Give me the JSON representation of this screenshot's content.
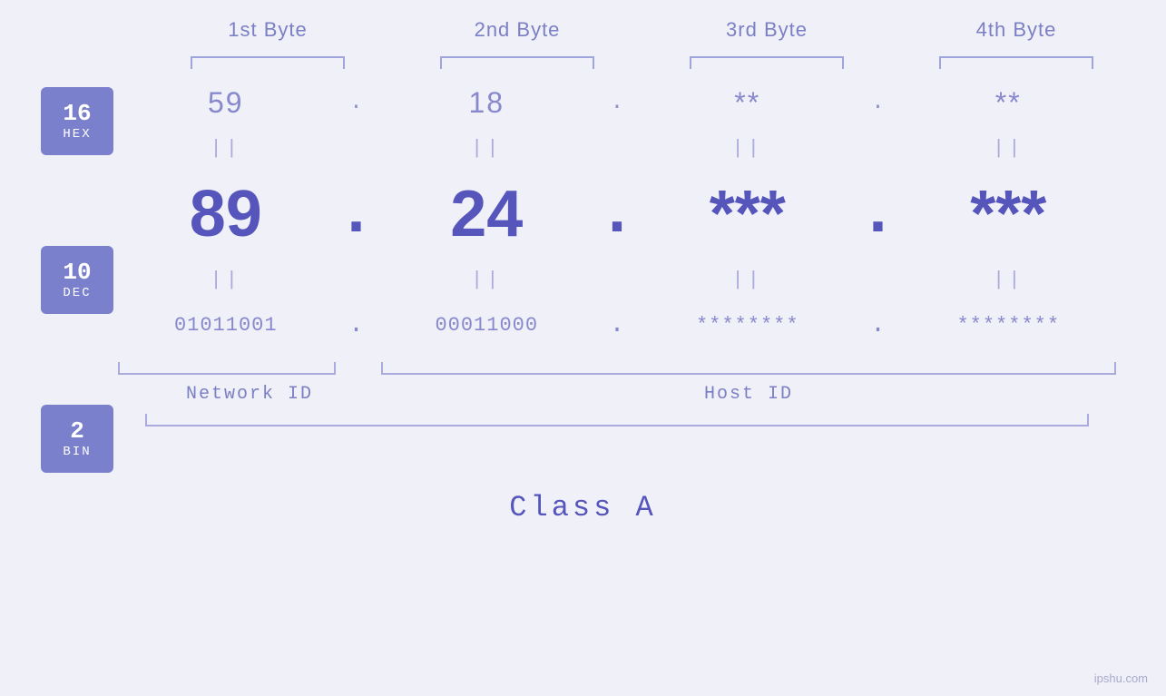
{
  "byteHeaders": {
    "b1": "1st Byte",
    "b2": "2nd Byte",
    "b3": "3rd Byte",
    "b4": "4th Byte"
  },
  "bases": {
    "hex": {
      "num": "16",
      "label": "HEX"
    },
    "dec": {
      "num": "10",
      "label": "DEC"
    },
    "bin": {
      "num": "2",
      "label": "BIN"
    }
  },
  "hexRow": {
    "b1": "59",
    "b2": "18",
    "b3": "**",
    "b4": "**",
    "dot": "."
  },
  "decRow": {
    "b1": "89",
    "b2": "24",
    "b3": "***",
    "b4": "***",
    "dot": "."
  },
  "binRow": {
    "b1": "01011001",
    "b2": "00011000",
    "b3": "********",
    "b4": "********",
    "dot": "."
  },
  "labels": {
    "networkId": "Network ID",
    "hostId": "Host ID",
    "classA": "Class A"
  },
  "watermark": "ipshu.com"
}
